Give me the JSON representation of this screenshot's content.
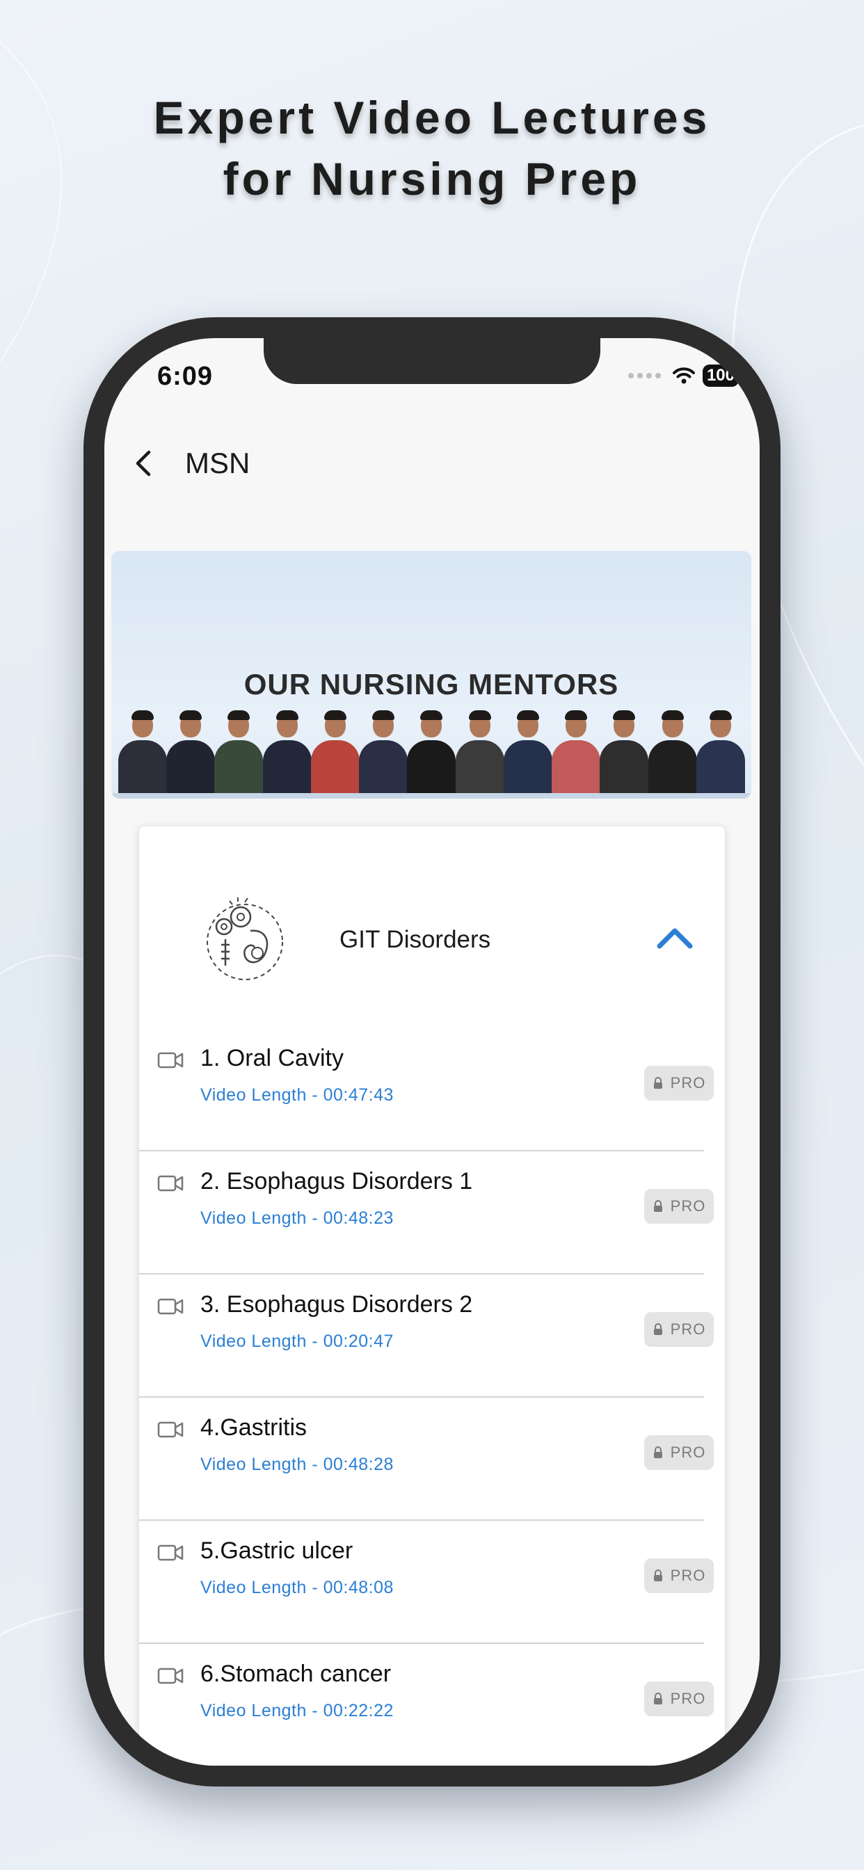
{
  "headline": {
    "line1": "Expert Video Lectures",
    "line2": "for Nursing Prep"
  },
  "status_bar": {
    "time": "6:09",
    "battery": "100",
    "icons": [
      "signal-dots-icon",
      "wifi-icon",
      "battery-icon"
    ]
  },
  "app_bar": {
    "title": "MSN",
    "back_icon": "chevron-left-icon"
  },
  "banner": {
    "title": "OUR NURSING MENTORS",
    "mentor_count": 13
  },
  "topic": {
    "title": "GIT Disorders",
    "illustration": "digestive-system-gears-icon",
    "toggle_icon": "chevron-up-icon",
    "expanded": true
  },
  "lessons": [
    {
      "title": "1. Oral Cavity",
      "length": "Video Length - 00:47:43",
      "badge": "PRO"
    },
    {
      "title": "2. Esophagus Disorders 1",
      "length": "Video Length - 00:48:23",
      "badge": "PRO"
    },
    {
      "title": "3. Esophagus Disorders 2",
      "length": "Video Length - 00:20:47",
      "badge": "PRO"
    },
    {
      "title": "4.Gastritis",
      "length": "Video Length - 00:48:28",
      "badge": "PRO"
    },
    {
      "title": "5.Gastric ulcer",
      "length": "Video Length - 00:48:08",
      "badge": "PRO"
    },
    {
      "title": "6.Stomach cancer",
      "length": "Video Length - 00:22:22",
      "badge": "PRO"
    }
  ],
  "colors": {
    "accent": "#2b7fd4",
    "phone_frame": "#2d2d2d",
    "badge_bg": "#e4e4e4",
    "badge_text": "#7a7a7a"
  }
}
